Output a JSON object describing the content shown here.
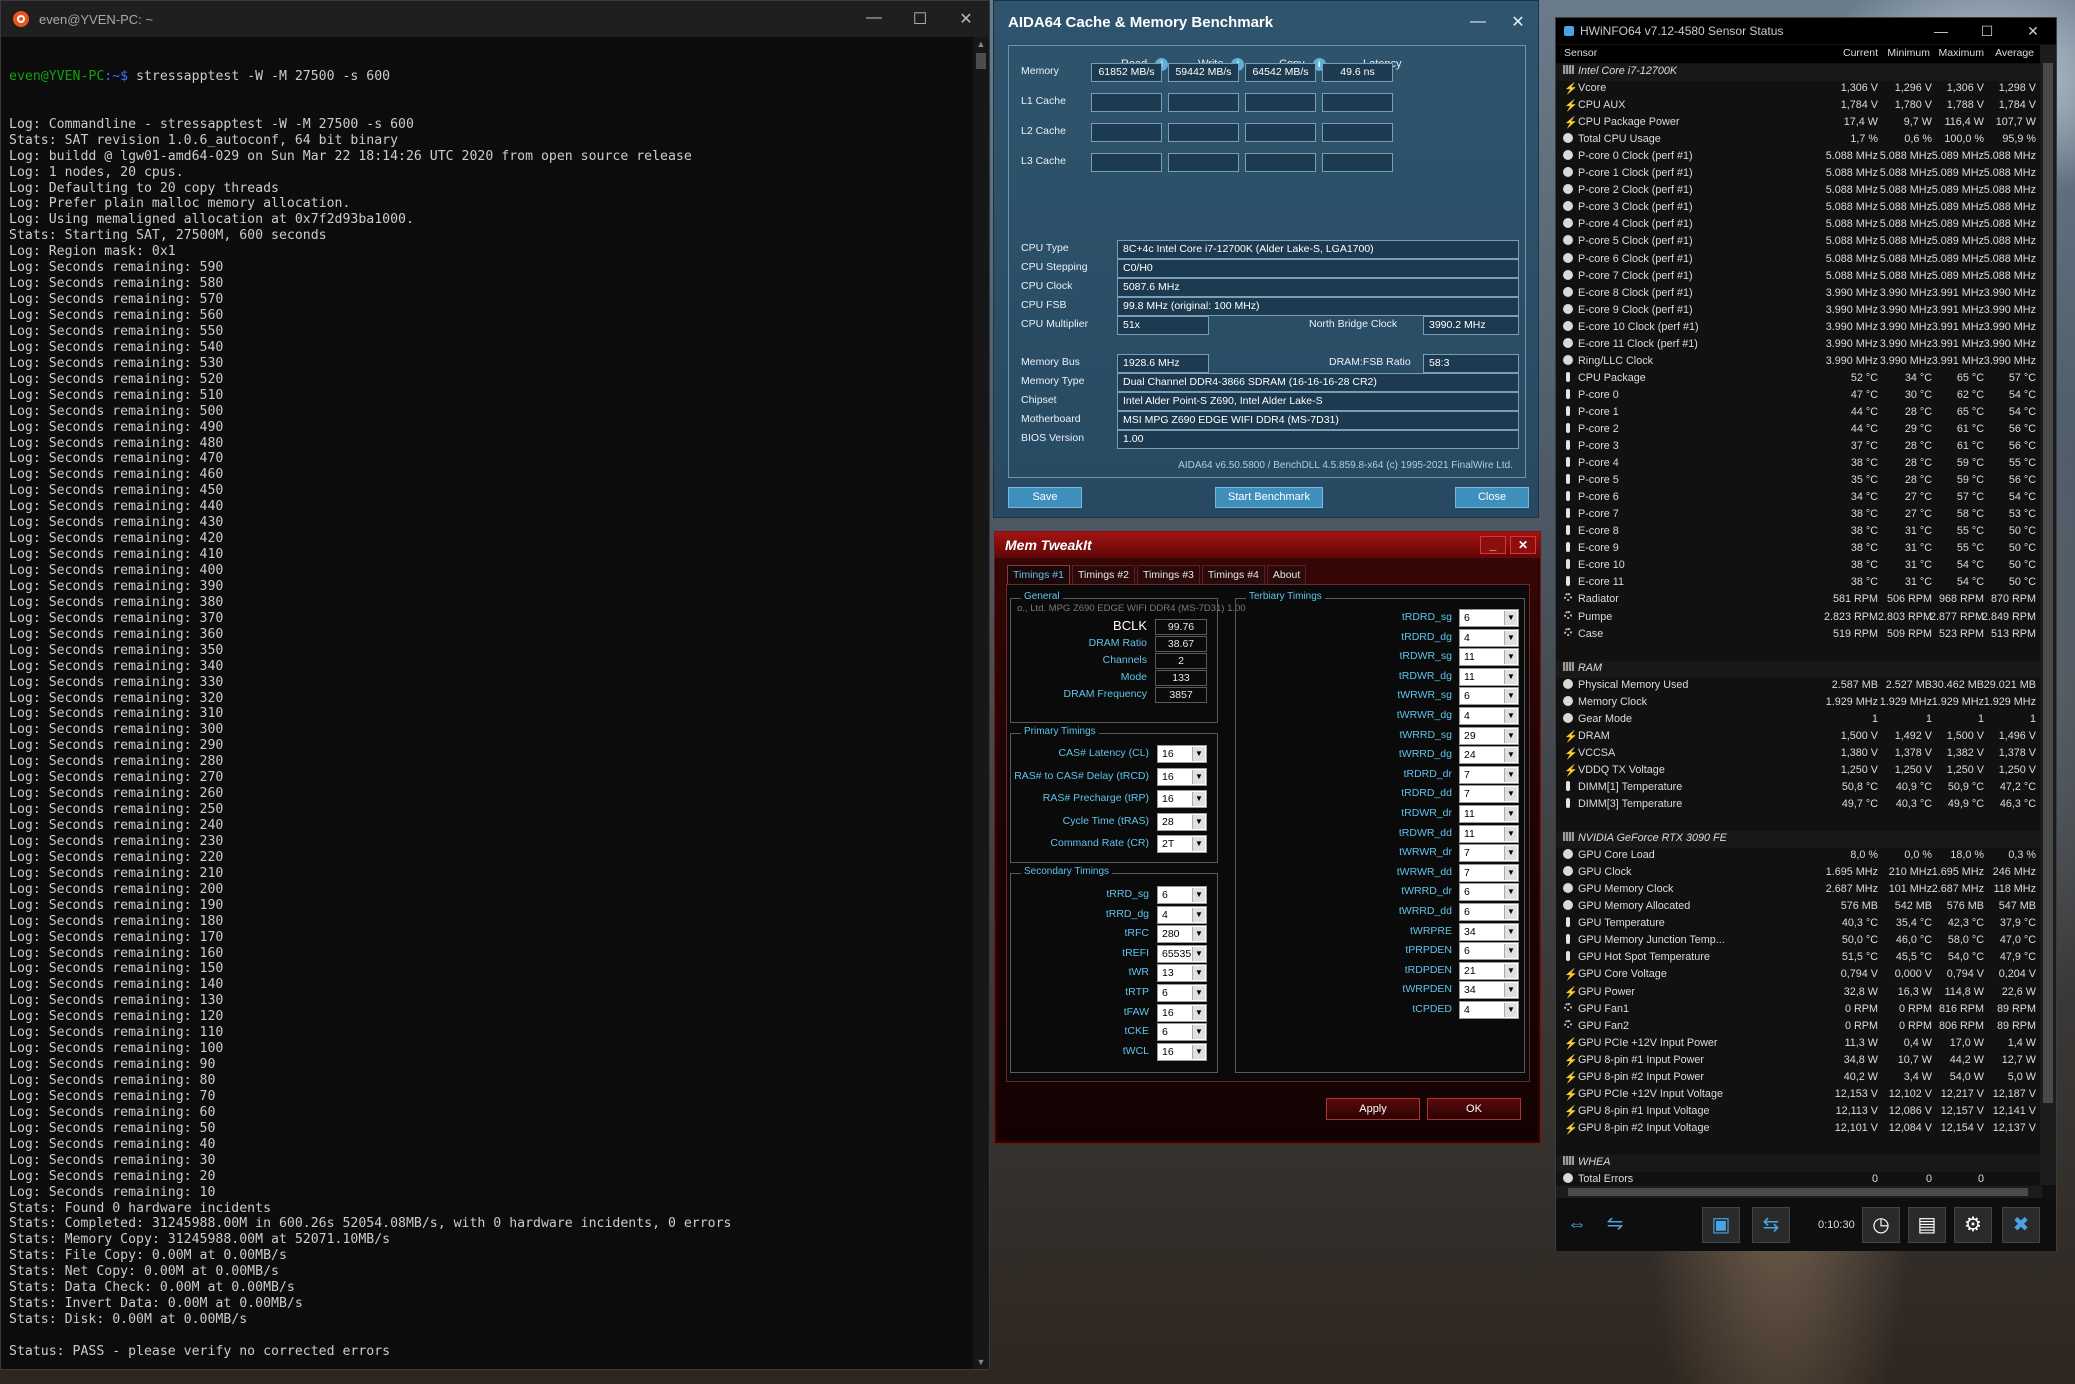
{
  "terminal": {
    "title": "even@YVEN-PC: ~",
    "prompt_user": "even@YVEN-PC",
    "prompt_path": ":~$",
    "command": " stressapptest -W -M 27500 -s 600",
    "lines": [
      "Log: Commandline - stressapptest -W -M 27500 -s 600",
      "Stats: SAT revision 1.0.6_autoconf, 64 bit binary",
      "Log: buildd @ lgw01-amd64-029 on Sun Mar 22 18:14:26 UTC 2020 from open source release",
      "Log: 1 nodes, 20 cpus.",
      "Log: Defaulting to 20 copy threads",
      "Log: Prefer plain malloc memory allocation.",
      "Log: Using memaligned allocation at 0x7f2d93ba1000.",
      "Stats: Starting SAT, 27500M, 600 seconds",
      "Log: Region mask: 0x1",
      "Log: Seconds remaining: 590",
      "Log: Seconds remaining: 580",
      "Log: Seconds remaining: 570",
      "Log: Seconds remaining: 560",
      "Log: Seconds remaining: 550",
      "Log: Seconds remaining: 540",
      "Log: Seconds remaining: 530",
      "Log: Seconds remaining: 520",
      "Log: Seconds remaining: 510",
      "Log: Seconds remaining: 500",
      "Log: Seconds remaining: 490",
      "Log: Seconds remaining: 480",
      "Log: Seconds remaining: 470",
      "Log: Seconds remaining: 460",
      "Log: Seconds remaining: 450",
      "Log: Seconds remaining: 440",
      "Log: Seconds remaining: 430",
      "Log: Seconds remaining: 420",
      "Log: Seconds remaining: 410",
      "Log: Seconds remaining: 400",
      "Log: Seconds remaining: 390",
      "Log: Seconds remaining: 380",
      "Log: Seconds remaining: 370",
      "Log: Seconds remaining: 360",
      "Log: Seconds remaining: 350",
      "Log: Seconds remaining: 340",
      "Log: Seconds remaining: 330",
      "Log: Seconds remaining: 320",
      "Log: Seconds remaining: 310",
      "Log: Seconds remaining: 300",
      "Log: Seconds remaining: 290",
      "Log: Seconds remaining: 280",
      "Log: Seconds remaining: 270",
      "Log: Seconds remaining: 260",
      "Log: Seconds remaining: 250",
      "Log: Seconds remaining: 240",
      "Log: Seconds remaining: 230",
      "Log: Seconds remaining: 220",
      "Log: Seconds remaining: 210",
      "Log: Seconds remaining: 200",
      "Log: Seconds remaining: 190",
      "Log: Seconds remaining: 180",
      "Log: Seconds remaining: 170",
      "Log: Seconds remaining: 160",
      "Log: Seconds remaining: 150",
      "Log: Seconds remaining: 140",
      "Log: Seconds remaining: 130",
      "Log: Seconds remaining: 120",
      "Log: Seconds remaining: 110",
      "Log: Seconds remaining: 100",
      "Log: Seconds remaining: 90",
      "Log: Seconds remaining: 80",
      "Log: Seconds remaining: 70",
      "Log: Seconds remaining: 60",
      "Log: Seconds remaining: 50",
      "Log: Seconds remaining: 40",
      "Log: Seconds remaining: 30",
      "Log: Seconds remaining: 20",
      "Log: Seconds remaining: 10",
      "Stats: Found 0 hardware incidents",
      "Stats: Completed: 31245988.00M in 600.26s 52054.08MB/s, with 0 hardware incidents, 0 errors",
      "Stats: Memory Copy: 31245988.00M at 52071.10MB/s",
      "Stats: File Copy: 0.00M at 0.00MB/s",
      "Stats: Net Copy: 0.00M at 0.00MB/s",
      "Stats: Data Check: 0.00M at 0.00MB/s",
      "Stats: Invert Data: 0.00M at 0.00MB/s",
      "Stats: Disk: 0.00M at 0.00MB/s",
      "",
      "Status: PASS - please verify no corrected errors",
      ""
    ]
  },
  "aida": {
    "title": "AIDA64 Cache & Memory Benchmark",
    "headers": {
      "read": "Read",
      "write": "Write",
      "copy": "Copy",
      "latency": "Latency"
    },
    "bench_rows": [
      {
        "label": "Memory",
        "read": "61852 MB/s",
        "write": "59442 MB/s",
        "copy": "64542 MB/s",
        "latency": "49.6 ns"
      },
      {
        "label": "L1 Cache",
        "read": "",
        "write": "",
        "copy": "",
        "latency": ""
      },
      {
        "label": "L2 Cache",
        "read": "",
        "write": "",
        "copy": "",
        "latency": ""
      },
      {
        "label": "L3 Cache",
        "read": "",
        "write": "",
        "copy": "",
        "latency": ""
      }
    ],
    "cpu_type_label": "CPU Type",
    "cpu_type": "8C+4c Intel Core i7-12700K  (Alder Lake-S, LGA1700)",
    "cpu_stepping_label": "CPU Stepping",
    "cpu_stepping": "C0/H0",
    "cpu_clock_label": "CPU Clock",
    "cpu_clock": "5087.6 MHz",
    "cpu_fsb_label": "CPU FSB",
    "cpu_fsb": "99.8 MHz  (original: 100 MHz)",
    "cpu_mult_label": "CPU Multiplier",
    "cpu_mult": "51x",
    "nb_clock_label": "North Bridge Clock",
    "nb_clock": "3990.2 MHz",
    "mem_bus_label": "Memory Bus",
    "mem_bus": "1928.6 MHz",
    "dram_fsb_label": "DRAM:FSB Ratio",
    "dram_fsb": "58:3",
    "mem_type_label": "Memory Type",
    "mem_type": "Dual Channel DDR4-3866 SDRAM  (16-16-16-28 CR2)",
    "chipset_label": "Chipset",
    "chipset": "Intel Alder Point-S Z690, Intel Alder Lake-S",
    "mobo_label": "Motherboard",
    "mobo": "MSI MPG Z690 EDGE WIFI DDR4 (MS-7D31)",
    "bios_label": "BIOS Version",
    "bios": "1.00",
    "footer": "AIDA64 v6.50.5800 / BenchDLL 4.5.859.8-x64  (c) 1995-2021 FinalWire Ltd.",
    "buttons": {
      "save": "Save",
      "start": "Start Benchmark",
      "close": "Close"
    }
  },
  "mti": {
    "title": "Mem TweakIt",
    "tabs": [
      "Timings #1",
      "Timings #2",
      "Timings #3",
      "Timings #4",
      "About"
    ],
    "general_title": "General",
    "board": "o., Ltd. MPG Z690 EDGE WIFI DDR4 (MS-7D31) 1.00",
    "general": [
      {
        "label": "BCLK",
        "value": "99.76"
      },
      {
        "label": "DRAM Ratio",
        "value": "38.67"
      },
      {
        "label": "Channels",
        "value": "2"
      },
      {
        "label": "Mode",
        "value": "133"
      },
      {
        "label": "DRAM Frequency",
        "value": "3857"
      }
    ],
    "primary_title": "Primary Timings",
    "primary": [
      {
        "label": "CAS# Latency (CL)",
        "value": "16"
      },
      {
        "label": "RAS# to CAS# Delay (tRCD)",
        "value": "16"
      },
      {
        "label": "RAS# Precharge (tRP)",
        "value": "16"
      },
      {
        "label": "Cycle Time (tRAS)",
        "value": "28"
      },
      {
        "label": "Command Rate (CR)",
        "value": "2T"
      }
    ],
    "secondary_title": "Secondary Timings",
    "secondary": [
      {
        "label": "tRRD_sg",
        "value": "6"
      },
      {
        "label": "tRRD_dg",
        "value": "4"
      },
      {
        "label": "tRFC",
        "value": "280"
      },
      {
        "label": "tREFI",
        "value": "65535"
      },
      {
        "label": "tWR",
        "value": "13"
      },
      {
        "label": "tRTP",
        "value": "6"
      },
      {
        "label": "tFAW",
        "value": "16"
      },
      {
        "label": "tCKE",
        "value": "6"
      },
      {
        "label": "tWCL",
        "value": "16"
      }
    ],
    "tertiary_title": "Terbiary Timings",
    "tertiary": [
      {
        "label": "tRDRD_sg",
        "value": "6"
      },
      {
        "label": "tRDRD_dg",
        "value": "4"
      },
      {
        "label": "tRDWR_sg",
        "value": "11"
      },
      {
        "label": "tRDWR_dg",
        "value": "11"
      },
      {
        "label": "tWRWR_sg",
        "value": "6"
      },
      {
        "label": "tWRWR_dg",
        "value": "4"
      },
      {
        "label": "tWRRD_sg",
        "value": "29"
      },
      {
        "label": "tWRRD_dg",
        "value": "24"
      },
      {
        "label": "tRDRD_dr",
        "value": "7"
      },
      {
        "label": "tRDRD_dd",
        "value": "7"
      },
      {
        "label": "tRDWR_dr",
        "value": "11"
      },
      {
        "label": "tRDWR_dd",
        "value": "11"
      },
      {
        "label": "tWRWR_dr",
        "value": "7"
      },
      {
        "label": "tWRWR_dd",
        "value": "7"
      },
      {
        "label": "tWRRD_dr",
        "value": "6"
      },
      {
        "label": "tWRRD_dd",
        "value": "6"
      },
      {
        "label": "tWRPRE",
        "value": "34"
      },
      {
        "label": "tPRPDEN",
        "value": "6"
      },
      {
        "label": "tRDPDEN",
        "value": "21"
      },
      {
        "label": "tWRPDEN",
        "value": "34"
      },
      {
        "label": "tCPDED",
        "value": "4"
      }
    ],
    "buttons": {
      "apply": "Apply",
      "ok": "OK"
    }
  },
  "hwinfo": {
    "title": "HWiNFO64 v7.12-4580 Sensor Status",
    "columns": {
      "sensor": "Sensor",
      "current": "Current",
      "minimum": "Minimum",
      "maximum": "Maximum",
      "average": "Average"
    },
    "time": "0:10:30",
    "rows": [
      {
        "t": "group",
        "n": "Intel Core i7-12700K"
      },
      {
        "i": "bolt",
        "n": "Vcore",
        "c": "1,306 V",
        "mi": "1,296 V",
        "ma": "1,306 V",
        "a": "1,298 V"
      },
      {
        "i": "bolt",
        "n": "CPU AUX",
        "c": "1,784 V",
        "mi": "1,780 V",
        "ma": "1,788 V",
        "a": "1,784 V"
      },
      {
        "i": "bolt",
        "n": "CPU Package Power",
        "c": "17,4 W",
        "mi": "9,7 W",
        "ma": "116,4 W",
        "a": "107,7 W"
      },
      {
        "i": "clock",
        "n": "Total CPU Usage",
        "c": "1,7 %",
        "mi": "0,6 %",
        "ma": "100,0 %",
        "a": "95,9 %"
      },
      {
        "i": "clock",
        "n": "P-core 0 Clock (perf #1)",
        "c": "5.088 MHz",
        "mi": "5.088 MHz",
        "ma": "5.089 MHz",
        "a": "5.088 MHz"
      },
      {
        "i": "clock",
        "n": "P-core 1 Clock (perf #1)",
        "c": "5.088 MHz",
        "mi": "5.088 MHz",
        "ma": "5.089 MHz",
        "a": "5.088 MHz"
      },
      {
        "i": "clock",
        "n": "P-core 2 Clock (perf #1)",
        "c": "5.088 MHz",
        "mi": "5.088 MHz",
        "ma": "5.089 MHz",
        "a": "5.088 MHz"
      },
      {
        "i": "clock",
        "n": "P-core 3 Clock (perf #1)",
        "c": "5.088 MHz",
        "mi": "5.088 MHz",
        "ma": "5.089 MHz",
        "a": "5.088 MHz"
      },
      {
        "i": "clock",
        "n": "P-core 4 Clock (perf #1)",
        "c": "5.088 MHz",
        "mi": "5.088 MHz",
        "ma": "5.089 MHz",
        "a": "5.088 MHz"
      },
      {
        "i": "clock",
        "n": "P-core 5 Clock (perf #1)",
        "c": "5.088 MHz",
        "mi": "5.088 MHz",
        "ma": "5.089 MHz",
        "a": "5.088 MHz"
      },
      {
        "i": "clock",
        "n": "P-core 6 Clock (perf #1)",
        "c": "5.088 MHz",
        "mi": "5.088 MHz",
        "ma": "5.089 MHz",
        "a": "5.088 MHz"
      },
      {
        "i": "clock",
        "n": "P-core 7 Clock (perf #1)",
        "c": "5.088 MHz",
        "mi": "5.088 MHz",
        "ma": "5.089 MHz",
        "a": "5.088 MHz"
      },
      {
        "i": "clock",
        "n": "E-core 8 Clock (perf #1)",
        "c": "3.990 MHz",
        "mi": "3.990 MHz",
        "ma": "3.991 MHz",
        "a": "3.990 MHz"
      },
      {
        "i": "clock",
        "n": "E-core 9 Clock (perf #1)",
        "c": "3.990 MHz",
        "mi": "3.990 MHz",
        "ma": "3.991 MHz",
        "a": "3.990 MHz"
      },
      {
        "i": "clock",
        "n": "E-core 10 Clock (perf #1)",
        "c": "3.990 MHz",
        "mi": "3.990 MHz",
        "ma": "3.991 MHz",
        "a": "3.990 MHz"
      },
      {
        "i": "clock",
        "n": "E-core 11 Clock (perf #1)",
        "c": "3.990 MHz",
        "mi": "3.990 MHz",
        "ma": "3.991 MHz",
        "a": "3.990 MHz"
      },
      {
        "i": "clock",
        "n": "Ring/LLC Clock",
        "c": "3.990 MHz",
        "mi": "3.990 MHz",
        "ma": "3.991 MHz",
        "a": "3.990 MHz"
      },
      {
        "i": "therm",
        "n": "CPU Package",
        "c": "52 °C",
        "mi": "34 °C",
        "ma": "65 °C",
        "a": "57 °C"
      },
      {
        "i": "therm",
        "n": "P-core 0",
        "c": "47 °C",
        "mi": "30 °C",
        "ma": "62 °C",
        "a": "54 °C"
      },
      {
        "i": "therm",
        "n": "P-core 1",
        "c": "44 °C",
        "mi": "28 °C",
        "ma": "65 °C",
        "a": "54 °C"
      },
      {
        "i": "therm",
        "n": "P-core 2",
        "c": "44 °C",
        "mi": "29 °C",
        "ma": "61 °C",
        "a": "56 °C"
      },
      {
        "i": "therm",
        "n": "P-core 3",
        "c": "37 °C",
        "mi": "28 °C",
        "ma": "61 °C",
        "a": "56 °C"
      },
      {
        "i": "therm",
        "n": "P-core 4",
        "c": "38 °C",
        "mi": "28 °C",
        "ma": "59 °C",
        "a": "55 °C"
      },
      {
        "i": "therm",
        "n": "P-core 5",
        "c": "35 °C",
        "mi": "28 °C",
        "ma": "59 °C",
        "a": "56 °C"
      },
      {
        "i": "therm",
        "n": "P-core 6",
        "c": "34 °C",
        "mi": "27 °C",
        "ma": "57 °C",
        "a": "54 °C"
      },
      {
        "i": "therm",
        "n": "P-core 7",
        "c": "38 °C",
        "mi": "27 °C",
        "ma": "58 °C",
        "a": "53 °C"
      },
      {
        "i": "therm",
        "n": "E-core 8",
        "c": "38 °C",
        "mi": "31 °C",
        "ma": "55 °C",
        "a": "50 °C"
      },
      {
        "i": "therm",
        "n": "E-core 9",
        "c": "38 °C",
        "mi": "31 °C",
        "ma": "55 °C",
        "a": "50 °C"
      },
      {
        "i": "therm",
        "n": "E-core 10",
        "c": "38 °C",
        "mi": "31 °C",
        "ma": "54 °C",
        "a": "50 °C"
      },
      {
        "i": "therm",
        "n": "E-core 11",
        "c": "38 °C",
        "mi": "31 °C",
        "ma": "54 °C",
        "a": "50 °C"
      },
      {
        "i": "fan",
        "n": "Radiator",
        "c": "581 RPM",
        "mi": "506 RPM",
        "ma": "968 RPM",
        "a": "870 RPM"
      },
      {
        "i": "fan",
        "n": "Pumpe",
        "c": "2.823 RPM",
        "mi": "2.803 RPM",
        "ma": "2.877 RPM",
        "a": "2.849 RPM"
      },
      {
        "i": "fan",
        "n": "Case",
        "c": "519 RPM",
        "mi": "509 RPM",
        "ma": "523 RPM",
        "a": "513 RPM"
      },
      {
        "t": "blank"
      },
      {
        "t": "group",
        "n": "RAM"
      },
      {
        "i": "clock",
        "n": "Physical Memory Used",
        "c": "2.587 MB",
        "mi": "2.527 MB",
        "ma": "30.462 MB",
        "a": "29.021 MB"
      },
      {
        "i": "clock",
        "n": "Memory Clock",
        "c": "1.929 MHz",
        "mi": "1.929 MHz",
        "ma": "1.929 MHz",
        "a": "1.929 MHz"
      },
      {
        "i": "clock",
        "n": "Gear Mode",
        "c": "1",
        "mi": "1",
        "ma": "1",
        "a": "1"
      },
      {
        "i": "bolt",
        "n": "DRAM",
        "c": "1,500 V",
        "mi": "1,492 V",
        "ma": "1,500 V",
        "a": "1,496 V"
      },
      {
        "i": "bolt",
        "n": "VCCSA",
        "c": "1,380 V",
        "mi": "1,378 V",
        "ma": "1,382 V",
        "a": "1,378 V"
      },
      {
        "i": "bolt",
        "n": "VDDQ TX Voltage",
        "c": "1,250 V",
        "mi": "1,250 V",
        "ma": "1,250 V",
        "a": "1,250 V"
      },
      {
        "i": "therm",
        "n": "DIMM[1] Temperature",
        "c": "50,8 °C",
        "mi": "40,9 °C",
        "ma": "50,9 °C",
        "a": "47,2 °C"
      },
      {
        "i": "therm",
        "n": "DIMM[3] Temperature",
        "c": "49,7 °C",
        "mi": "40,3 °C",
        "ma": "49,9 °C",
        "a": "46,3 °C"
      },
      {
        "t": "blank"
      },
      {
        "t": "group",
        "n": "NVIDIA GeForce RTX 3090 FE"
      },
      {
        "i": "clock",
        "n": "GPU Core Load",
        "c": "8,0 %",
        "mi": "0,0 %",
        "ma": "18,0 %",
        "a": "0,3 %"
      },
      {
        "i": "clock",
        "n": "GPU Clock",
        "c": "1.695 MHz",
        "mi": "210 MHz",
        "ma": "1.695 MHz",
        "a": "246 MHz"
      },
      {
        "i": "clock",
        "n": "GPU Memory Clock",
        "c": "2.687 MHz",
        "mi": "101 MHz",
        "ma": "2.687 MHz",
        "a": "118 MHz"
      },
      {
        "i": "clock",
        "n": "GPU Memory Allocated",
        "c": "576 MB",
        "mi": "542 MB",
        "ma": "576 MB",
        "a": "547 MB"
      },
      {
        "i": "therm",
        "n": "GPU Temperature",
        "c": "40,3 °C",
        "mi": "35,4 °C",
        "ma": "42,3 °C",
        "a": "37,9 °C"
      },
      {
        "i": "therm",
        "n": "GPU Memory Junction Temp...",
        "c": "50,0 °C",
        "mi": "46,0 °C",
        "ma": "58,0 °C",
        "a": "47,0 °C"
      },
      {
        "i": "therm",
        "n": "GPU Hot Spot Temperature",
        "c": "51,5 °C",
        "mi": "45,5 °C",
        "ma": "54,0 °C",
        "a": "47,9 °C"
      },
      {
        "i": "bolt",
        "n": "GPU Core Voltage",
        "c": "0,794 V",
        "mi": "0,000 V",
        "ma": "0,794 V",
        "a": "0,204 V"
      },
      {
        "i": "bolt",
        "n": "GPU Power",
        "c": "32,8 W",
        "mi": "16,3 W",
        "ma": "114,8 W",
        "a": "22,6 W"
      },
      {
        "i": "fan",
        "n": "GPU Fan1",
        "c": "0 RPM",
        "mi": "0 RPM",
        "ma": "816 RPM",
        "a": "89 RPM"
      },
      {
        "i": "fan",
        "n": "GPU Fan2",
        "c": "0 RPM",
        "mi": "0 RPM",
        "ma": "806 RPM",
        "a": "89 RPM"
      },
      {
        "i": "bolt",
        "n": "GPU PCIe +12V Input Power",
        "c": "11,3 W",
        "mi": "0,4 W",
        "ma": "17,0 W",
        "a": "1,4 W"
      },
      {
        "i": "bolt",
        "n": "GPU 8-pin #1 Input Power",
        "c": "34,8 W",
        "mi": "10,7 W",
        "ma": "44,2 W",
        "a": "12,7 W"
      },
      {
        "i": "bolt",
        "n": "GPU 8-pin #2 Input Power",
        "c": "40,2 W",
        "mi": "3,4 W",
        "ma": "54,0 W",
        "a": "5,0 W"
      },
      {
        "i": "bolt",
        "n": "GPU PCIe +12V Input Voltage",
        "c": "12,153 V",
        "mi": "12,102 V",
        "ma": "12,217 V",
        "a": "12,187 V"
      },
      {
        "i": "bolt",
        "n": "GPU 8-pin #1 Input Voltage",
        "c": "12,113 V",
        "mi": "12,086 V",
        "ma": "12,157 V",
        "a": "12,141 V"
      },
      {
        "i": "bolt",
        "n": "GPU 8-pin #2 Input Voltage",
        "c": "12,101 V",
        "mi": "12,084 V",
        "ma": "12,154 V",
        "a": "12,137 V"
      },
      {
        "t": "blank"
      },
      {
        "t": "group",
        "n": "WHEA"
      },
      {
        "i": "clock",
        "n": "Total Errors",
        "c": "0",
        "mi": "0",
        "ma": "0",
        "a": ""
      }
    ]
  }
}
